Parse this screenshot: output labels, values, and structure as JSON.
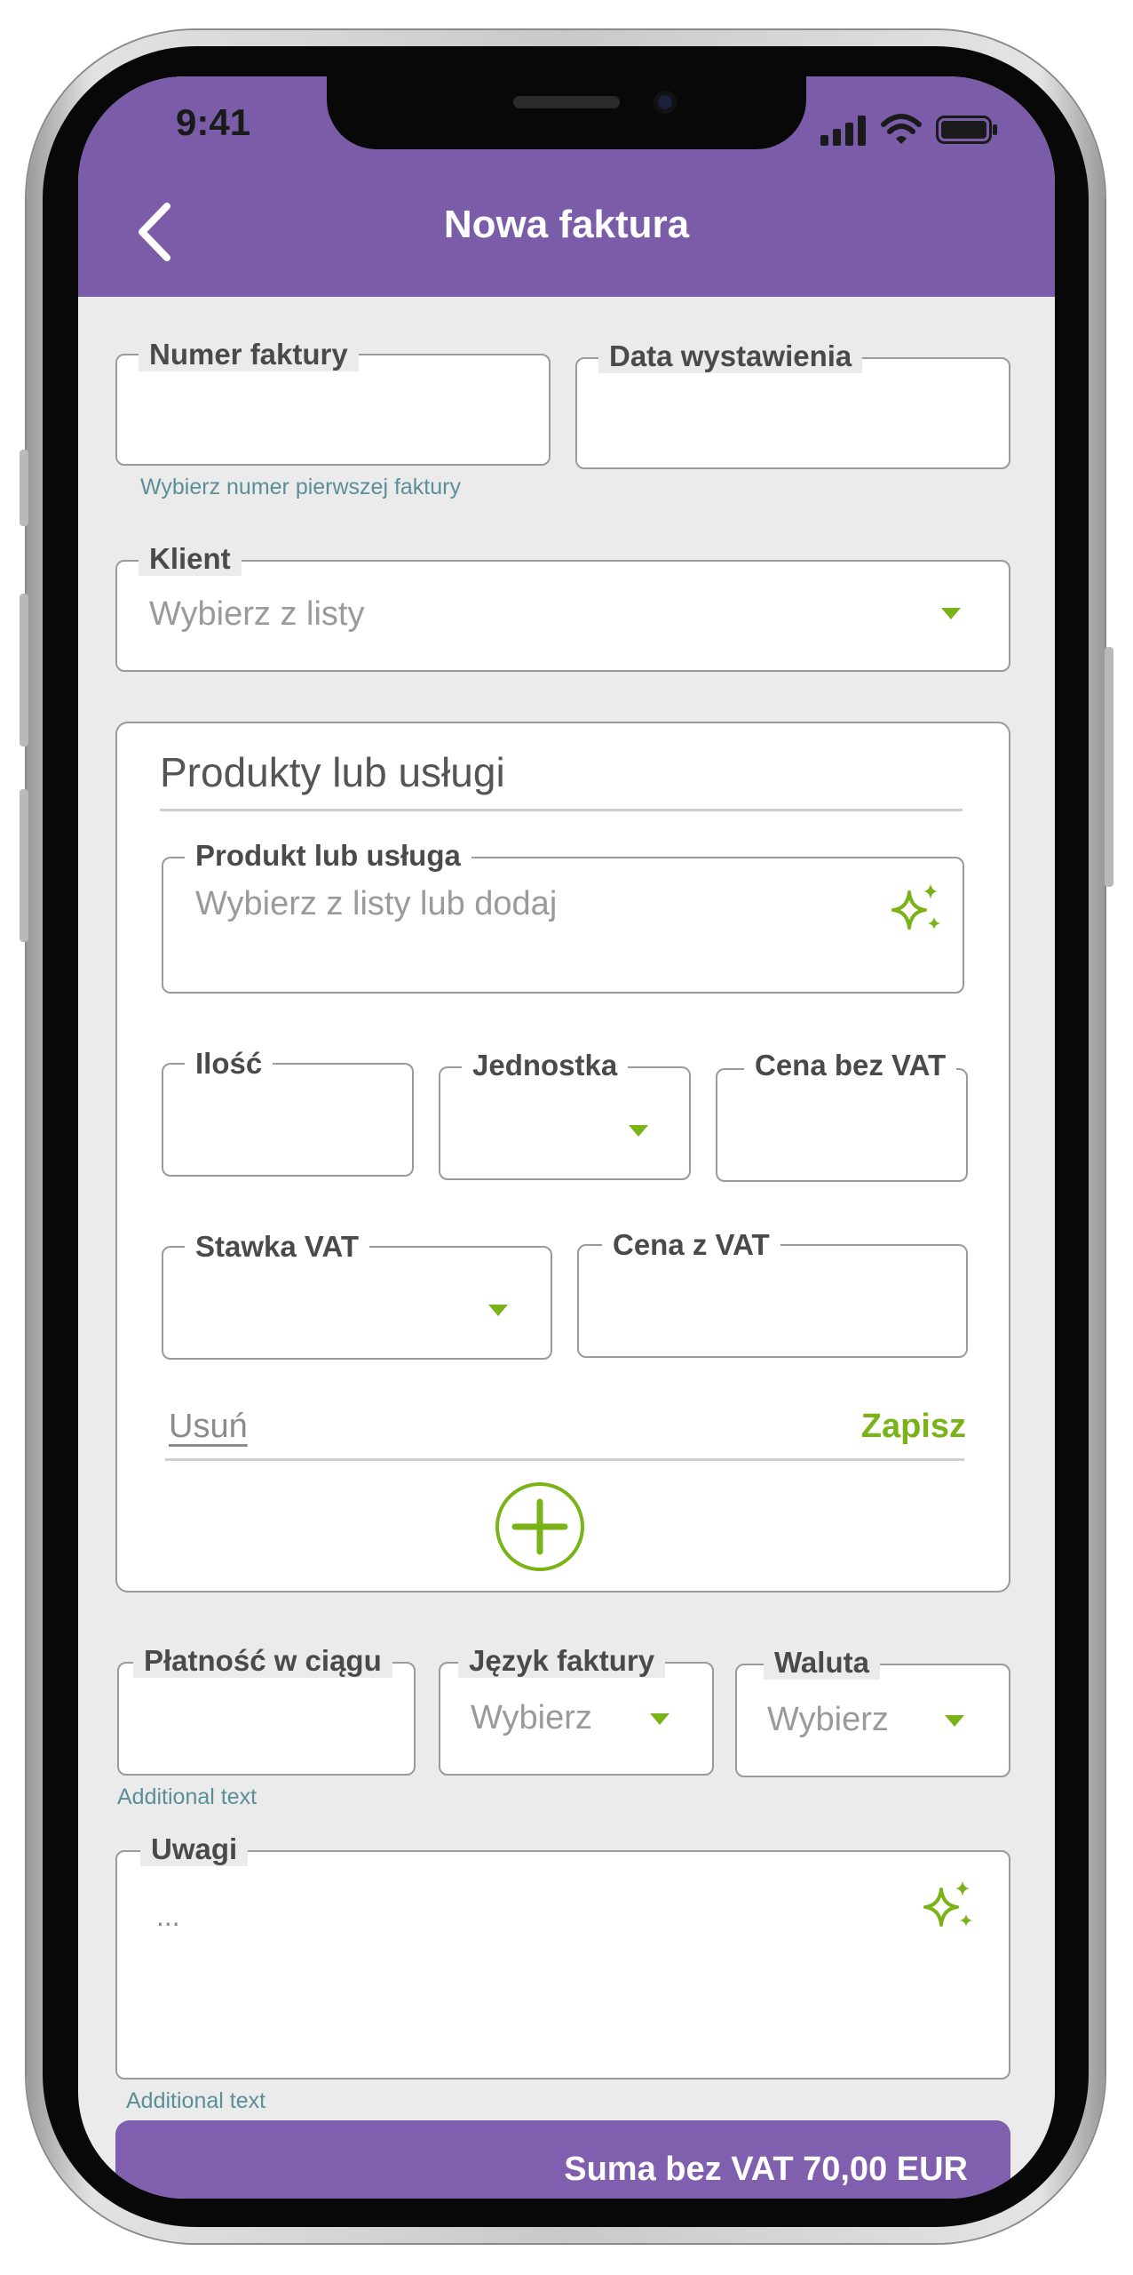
{
  "status_bar": {
    "time": "9:41"
  },
  "header": {
    "title": "Nowa faktura"
  },
  "invoice": {
    "number_label": "Numer faktury",
    "number_value": "",
    "date_label": "Data wystawienia",
    "date_value": "",
    "number_helper": "Wybierz numer pierwszej faktury"
  },
  "client": {
    "label": "Klient",
    "placeholder": "Wybierz z listy"
  },
  "products": {
    "section_title": "Produkty lub usługi",
    "product_label": "Produkt lub usługa",
    "product_placeholder": "Wybierz z listy lub dodaj",
    "quantity_label": "Ilość",
    "unit_label": "Jednostka",
    "net_price_label": "Cena bez VAT",
    "vat_rate_label": "Stawka VAT",
    "gross_price_label": "Cena z VAT",
    "delete_label": "Usuń",
    "save_label": "Zapisz"
  },
  "payment": {
    "term_label": "Płatność w ciągu",
    "term_helper": "Additional text",
    "language_label": "Język faktury",
    "language_placeholder": "Wybierz",
    "currency_label": "Waluta",
    "currency_placeholder": "Wybierz"
  },
  "notes": {
    "label": "Uwagi",
    "placeholder": "...",
    "helper": "Additional text"
  },
  "summary": {
    "text": "Suma bez VAT 70,00 EUR"
  },
  "colors": {
    "header": "#7a5ca8",
    "accent_green": "#7ab317",
    "footer": "#7f5fae"
  }
}
